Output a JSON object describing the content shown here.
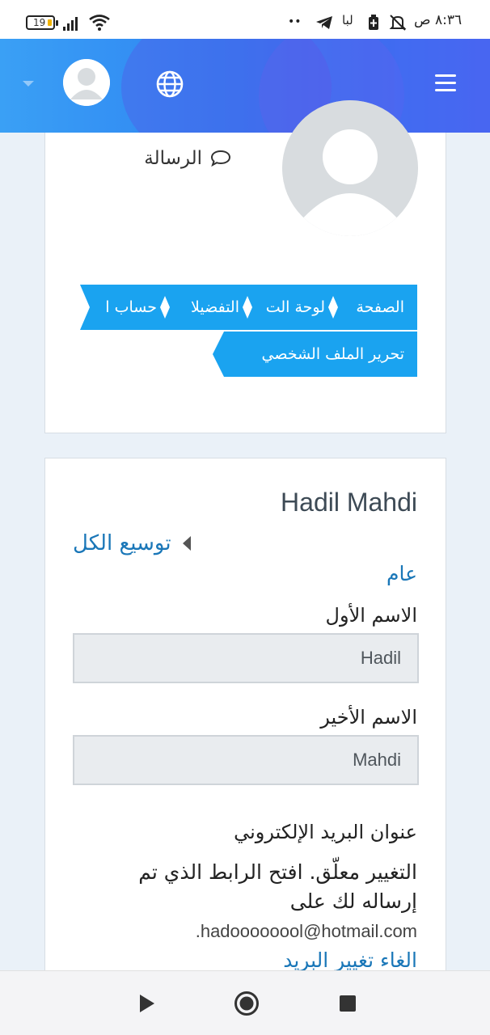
{
  "status_bar": {
    "time": "٨:٣٦ ص",
    "battery": "19",
    "dots": "••",
    "carrier_text": "لبا"
  },
  "header": {
    "menu_icon": "hamburger-icon",
    "language_icon": "globe-icon",
    "user_icon": "avatar",
    "dropdown_icon": "caret-down-icon",
    "colors": {
      "start": "#3aa0f5",
      "end": "#4a63ef"
    }
  },
  "profile_card": {
    "message_label": "الرسالة",
    "breadcrumbs": [
      "الصفحة",
      "لوحة الت",
      "التفضيلا",
      "حساب ا",
      "تحرير الملف الشخصي"
    ]
  },
  "edit_form": {
    "full_name": "Hadil Mahdi",
    "expand_all": "توسيع الكل",
    "section_general": "عام",
    "first_name_label": "الاسم الأول",
    "first_name_value": "Hadil",
    "last_name_label": "الاسم الأخير",
    "last_name_value": "Mahdi",
    "email_label": "عنوان البريد الإلكتروني",
    "pending_message": "التغيير معلّق. افتح الرابط الذي تم إرساله لك على",
    "email_value": ".hadoooooool@hotmail.com",
    "cancel_link": "الغاء تغيير البريد"
  },
  "nav_bar": {
    "back": "play-icon",
    "home": "home-circle-icon",
    "recents": "square-icon"
  },
  "colors": {
    "accent": "#1aa3f0",
    "link": "#1a77b8",
    "page_bg": "#eaf1f8"
  }
}
